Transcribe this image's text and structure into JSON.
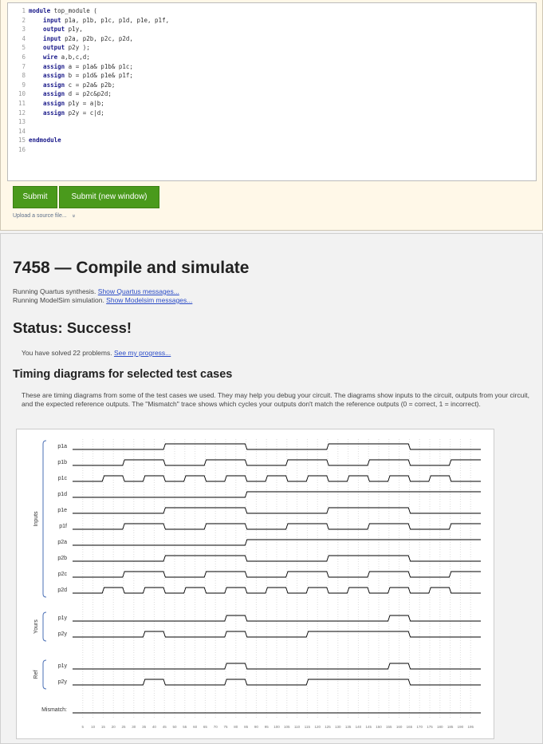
{
  "editor": {
    "lines": [
      {
        "num": "1",
        "kw": "module",
        "text": " top_module ("
      },
      {
        "num": "2",
        "kw": "    input",
        "text": " p1a, p1b, p1c, p1d, p1e, p1f,"
      },
      {
        "num": "3",
        "kw": "    output",
        "text": " p1y,"
      },
      {
        "num": "4",
        "kw": "    input",
        "text": " p2a, p2b, p2c, p2d,"
      },
      {
        "num": "5",
        "kw": "    output",
        "text": " p2y );"
      },
      {
        "num": "6",
        "kw": "    wire",
        "text": " a,b,c,d;"
      },
      {
        "num": "7",
        "kw": "    assign",
        "text": " a = p1a& p1b& p1c;"
      },
      {
        "num": "8",
        "kw": "    assign",
        "text": " b = p1d& p1e& p1f;"
      },
      {
        "num": "9",
        "kw": "    assign",
        "text": " c = p2a& p2b;"
      },
      {
        "num": "10",
        "kw": "    assign",
        "text": " d = p2c&p2d;"
      },
      {
        "num": "11",
        "kw": "    assign",
        "text": " p1y = a|b;"
      },
      {
        "num": "12",
        "kw": "    assign",
        "text": " p2y = c|d;"
      },
      {
        "num": "13",
        "kw": "",
        "text": ""
      },
      {
        "num": "14",
        "kw": "",
        "text": ""
      },
      {
        "num": "15",
        "kw": "endmodule",
        "text": ""
      },
      {
        "num": "16",
        "kw": "",
        "text": ""
      }
    ]
  },
  "buttons": {
    "submit": "Submit",
    "submit_new": "Submit (new window)"
  },
  "upload": {
    "label": "Upload a source file...",
    "icon": "chevron-down-icon",
    "glyph": "»"
  },
  "results": {
    "title": "7458 — Compile and simulate",
    "quartus_prefix": "Running Quartus synthesis. ",
    "quartus_link": "Show Quartus messages...",
    "modelsim_prefix": "Running ModelSim simulation. ",
    "modelsim_link": "Show Modelsim messages...",
    "status": "Status: Success!",
    "solved_prefix": "You have solved 22 problems. ",
    "solved_link": "See my progress...",
    "timing_heading": "Timing diagrams for selected test cases",
    "timing_desc": "These are timing diagrams from some of the test cases we used. They may help you debug your circuit. The diagrams show inputs to the circuit, outputs from your circuit, and the expected reference outputs. The \"Mismatch\" trace shows which cycles your outputs don't match the reference outputs (0 = correct, 1 = incorrect)."
  },
  "chart_data": {
    "type": "timing",
    "groups": [
      {
        "label": "Inputs",
        "signals": [
          "p1a",
          "p1b",
          "p1c",
          "p1d",
          "p1e",
          "p1f",
          "p2a",
          "p2b",
          "p2c",
          "p2d"
        ]
      },
      {
        "label": "Yours",
        "signals": [
          "p1y",
          "p2y"
        ]
      },
      {
        "label": "Ref",
        "signals": [
          "p1y",
          "p2y"
        ]
      }
    ],
    "x_ticks": [
      5,
      10,
      15,
      20,
      25,
      30,
      35,
      40,
      45,
      50,
      55,
      60,
      65,
      70,
      75,
      80,
      85,
      90,
      95,
      100,
      105,
      110,
      115,
      120,
      125,
      130,
      135,
      140,
      145,
      150,
      155,
      160,
      165,
      170,
      175,
      180,
      185,
      190,
      195
    ],
    "x_range": [
      0,
      200
    ],
    "traces": [
      {
        "name": "p1a",
        "group": "Inputs",
        "transitions": [
          [
            0,
            0
          ],
          [
            45,
            1
          ],
          [
            85,
            0
          ],
          [
            125,
            1
          ],
          [
            165,
            0
          ]
        ]
      },
      {
        "name": "p1b",
        "group": "Inputs",
        "transitions": [
          [
            0,
            0
          ],
          [
            25,
            1
          ],
          [
            45,
            0
          ],
          [
            65,
            1
          ],
          [
            85,
            0
          ],
          [
            105,
            1
          ],
          [
            125,
            0
          ],
          [
            145,
            1
          ],
          [
            165,
            0
          ],
          [
            185,
            1
          ]
        ]
      },
      {
        "name": "p1c",
        "group": "Inputs",
        "transitions": [
          [
            0,
            0
          ],
          [
            15,
            1
          ],
          [
            25,
            0
          ],
          [
            35,
            1
          ],
          [
            45,
            0
          ],
          [
            55,
            1
          ],
          [
            65,
            0
          ],
          [
            75,
            1
          ],
          [
            85,
            0
          ],
          [
            95,
            1
          ],
          [
            105,
            0
          ],
          [
            115,
            1
          ],
          [
            125,
            0
          ],
          [
            135,
            1
          ],
          [
            145,
            0
          ],
          [
            155,
            1
          ],
          [
            165,
            0
          ],
          [
            175,
            1
          ],
          [
            185,
            0
          ]
        ]
      },
      {
        "name": "p1d",
        "group": "Inputs",
        "transitions": [
          [
            0,
            0
          ],
          [
            85,
            1
          ]
        ]
      },
      {
        "name": "p1e",
        "group": "Inputs",
        "transitions": [
          [
            0,
            0
          ],
          [
            45,
            1
          ],
          [
            85,
            0
          ],
          [
            125,
            1
          ],
          [
            165,
            0
          ]
        ]
      },
      {
        "name": "p1f",
        "group": "Inputs",
        "transitions": [
          [
            0,
            0
          ],
          [
            25,
            1
          ],
          [
            45,
            0
          ],
          [
            65,
            1
          ],
          [
            85,
            0
          ],
          [
            105,
            1
          ],
          [
            125,
            0
          ],
          [
            145,
            1
          ],
          [
            165,
            0
          ],
          [
            185,
            1
          ]
        ]
      },
      {
        "name": "p2a",
        "group": "Inputs",
        "transitions": [
          [
            0,
            0
          ],
          [
            85,
            1
          ]
        ]
      },
      {
        "name": "p2b",
        "group": "Inputs",
        "transitions": [
          [
            0,
            0
          ],
          [
            45,
            1
          ],
          [
            85,
            0
          ],
          [
            125,
            1
          ],
          [
            165,
            0
          ]
        ]
      },
      {
        "name": "p2c",
        "group": "Inputs",
        "transitions": [
          [
            0,
            0
          ],
          [
            25,
            1
          ],
          [
            45,
            0
          ],
          [
            65,
            1
          ],
          [
            85,
            0
          ],
          [
            105,
            1
          ],
          [
            125,
            0
          ],
          [
            145,
            1
          ],
          [
            165,
            0
          ],
          [
            185,
            1
          ]
        ]
      },
      {
        "name": "p2d",
        "group": "Inputs",
        "transitions": [
          [
            0,
            0
          ],
          [
            15,
            1
          ],
          [
            25,
            0
          ],
          [
            35,
            1
          ],
          [
            45,
            0
          ],
          [
            55,
            1
          ],
          [
            65,
            0
          ],
          [
            75,
            1
          ],
          [
            85,
            0
          ],
          [
            95,
            1
          ],
          [
            105,
            0
          ],
          [
            115,
            1
          ],
          [
            125,
            0
          ],
          [
            135,
            1
          ],
          [
            145,
            0
          ],
          [
            155,
            1
          ],
          [
            165,
            0
          ],
          [
            175,
            1
          ],
          [
            185,
            0
          ]
        ]
      },
      {
        "name": "p1y",
        "group": "Yours",
        "transitions": [
          [
            0,
            0
          ],
          [
            75,
            1
          ],
          [
            85,
            0
          ],
          [
            155,
            1
          ],
          [
            165,
            0
          ]
        ]
      },
      {
        "name": "p2y",
        "group": "Yours",
        "transitions": [
          [
            0,
            0
          ],
          [
            35,
            1
          ],
          [
            45,
            0
          ],
          [
            75,
            1
          ],
          [
            85,
            0
          ],
          [
            115,
            1
          ],
          [
            165,
            0
          ]
        ]
      },
      {
        "name": "p1y",
        "group": "Ref",
        "transitions": [
          [
            0,
            0
          ],
          [
            75,
            1
          ],
          [
            85,
            0
          ],
          [
            155,
            1
          ],
          [
            165,
            0
          ]
        ]
      },
      {
        "name": "p2y",
        "group": "Ref",
        "transitions": [
          [
            0,
            0
          ],
          [
            35,
            1
          ],
          [
            45,
            0
          ],
          [
            75,
            1
          ],
          [
            85,
            0
          ],
          [
            115,
            1
          ],
          [
            165,
            0
          ]
        ]
      },
      {
        "name": "Mismatch:",
        "group": "",
        "transitions": [
          [
            0,
            0
          ]
        ]
      }
    ],
    "grid": true
  },
  "colors": {
    "submit": "#4a9a1c",
    "link": "#2b4cc7",
    "group_bracket": "#4a6fb5",
    "trace": "#000000"
  }
}
